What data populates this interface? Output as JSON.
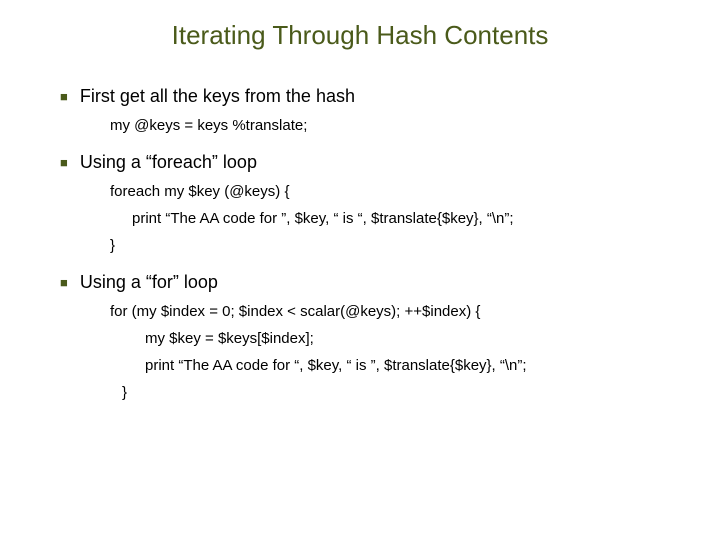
{
  "title": "Iterating Through Hash Contents",
  "sections": [
    {
      "heading": "First get all the keys from the hash",
      "lines": [
        {
          "text": "my @keys = keys %translate;",
          "indent": "indent-1"
        }
      ]
    },
    {
      "heading": "Using a “foreach” loop",
      "lines": [
        {
          "text": "foreach my $key (@keys) {",
          "indent": "indent-1"
        },
        {
          "text": "print “The AA code for ”, $key, “ is “, $translate{$key}, “\\n”;",
          "indent": "indent-2"
        },
        {
          "text": "}",
          "indent": "indent-1"
        }
      ]
    },
    {
      "heading": "Using a “for” loop",
      "lines": [
        {
          "text": "for (my $index = 0; $index < scalar(@keys); ++$index) {",
          "indent": "indent-1"
        },
        {
          "text": "my $key = $keys[$index];",
          "indent": "indent-3"
        },
        {
          "text": "print “The AA code for “, $key, “ is ”, $translate{$key}, “\\n”;",
          "indent": "indent-3"
        },
        {
          "text": "}",
          "indent": "indent-4"
        }
      ]
    }
  ]
}
